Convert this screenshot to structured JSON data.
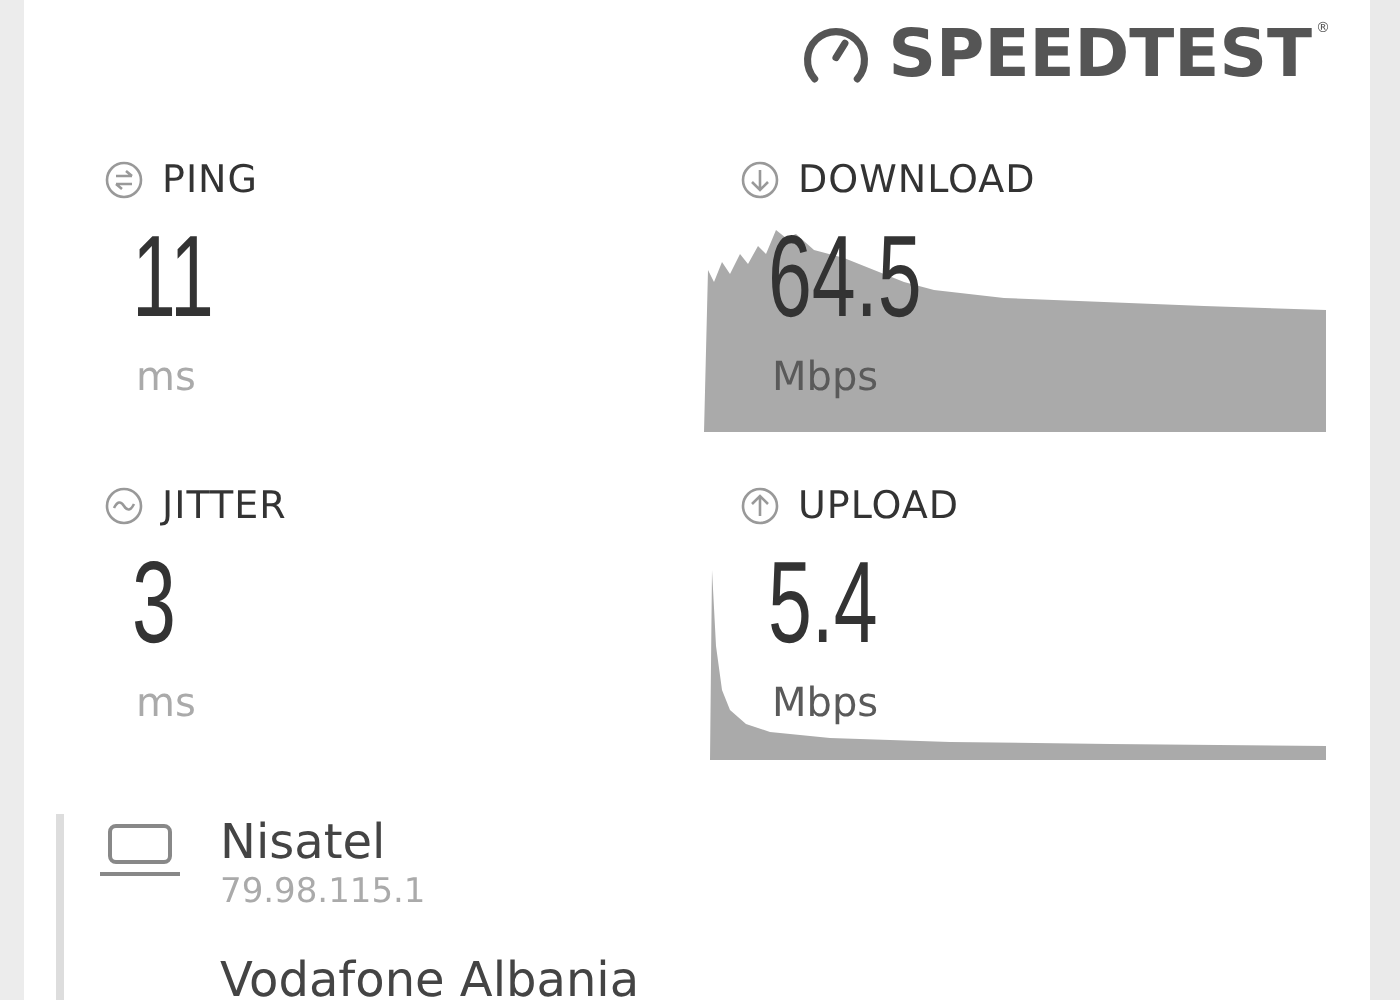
{
  "logo": {
    "text": "SPEEDTEST",
    "mark": "®"
  },
  "metrics": [
    {
      "kind": "ping",
      "label": "PING",
      "value": "11",
      "unit": "ms"
    },
    {
      "kind": "download",
      "label": "DOWNLOAD",
      "value": "64.5",
      "unit": "Mbps"
    },
    {
      "kind": "jitter",
      "label": "JITTER",
      "value": "3",
      "unit": "ms"
    },
    {
      "kind": "upload",
      "label": "UPLOAD",
      "value": "5.4",
      "unit": "Mbps"
    }
  ],
  "server": {
    "isp": "Nisatel",
    "ip": "79.98.115.1",
    "host": "Vodafone Albania"
  }
}
